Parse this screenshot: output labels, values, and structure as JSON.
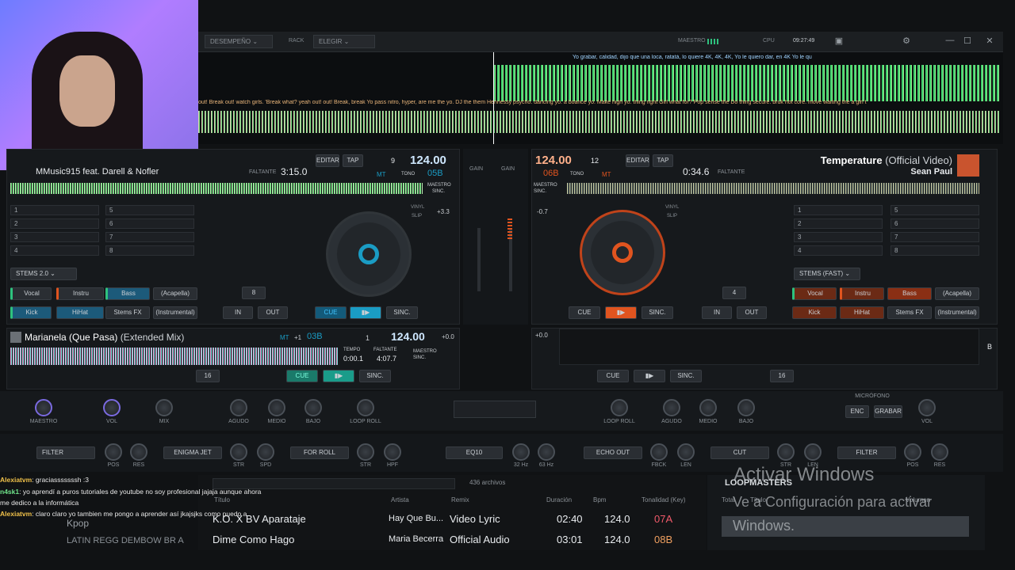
{
  "topbar": {
    "performance": "DESEMPEÑO",
    "rack_label": "RACK",
    "rack_value": "ELEGIR",
    "master_label": "MAESTRO",
    "cpu_label": "CPU",
    "clock": "09:27:49"
  },
  "wave_top": {
    "lyrics_top": "Yo grabar, calidad, dijo que una loca, ratatá, lo quiere 4K, 4K, 4K, Yo  le quiero dar, en 4K  Yo le qu",
    "lyrics_bottom": "out! Break out! watch girls.   'Break what? yeah out! out! Break,  break Yo pass nitro, hyper, are me the yo. DJ the them Hennessy psycho. dancing yo. a boance yo. Make high yo. thing right Girl what for? Pop sense the Do thing secure. bruk hot core. move waiting the a girl t"
  },
  "deck1": {
    "title": "MMusic915 feat. Darell & Nofler",
    "remaining_label": "FALTANTE",
    "time": "3:15.0",
    "edit": "EDITAR",
    "tap": "TAP",
    "bpm": "124.00",
    "beat": "9",
    "key": "05B",
    "mt": "MT",
    "tono": "TONO",
    "master": "MAESTRO",
    "sync": "SINC.",
    "pitch": "+3.3",
    "vinyl": "VINYL",
    "slip": "SLIP",
    "stems": "STEMS 2.0",
    "vocal": "Vocal",
    "instru": "Instru",
    "bass": "Bass",
    "acapella": "(Acapella)",
    "kick": "Kick",
    "hihat": "HiHat",
    "stemsfx": "Stems FX",
    "instrumental": "(Instrumental)",
    "loop": "8",
    "in": "IN",
    "out": "OUT",
    "cue": "CUE",
    "play": "▶ॱ",
    "sinc": "SINC.",
    "pads": [
      "1",
      "2",
      "3",
      "4",
      "5",
      "6",
      "7",
      "8"
    ]
  },
  "deck2": {
    "title": "Temperature",
    "title_suffix": "(Official Video)",
    "artist": "Sean Paul",
    "bpm": "124.00",
    "beat": "12",
    "key": "06B",
    "mt": "MT",
    "tono": "TONO",
    "edit": "EDITAR",
    "tap": "TAP",
    "time": "0:34.6",
    "remaining_label": "FALTANTE",
    "master": "MAESTRO",
    "sync": "SINC.",
    "pitch": "-0.7",
    "vinyl": "VINYL",
    "slip": "SLIP",
    "stems": "STEMS (FAST)",
    "vocal": "Vocal",
    "instru": "Instru",
    "bass": "Bass",
    "acapella": "(Acapella)",
    "kick": "Kick",
    "hihat": "HiHat",
    "stemsfx": "Stems FX",
    "instrumental": "(Instrumental)",
    "loop": "4",
    "in": "IN",
    "out": "OUT",
    "cue": "CUE",
    "sinc": "SINC.",
    "pads": [
      "1",
      "2",
      "3",
      "4",
      "5",
      "6",
      "7",
      "8"
    ]
  },
  "deck3": {
    "title": "Marianela (Que Pasa)",
    "title_suffix": "(Extended Mix)",
    "mt": "MT",
    "pitch_shift": "+1",
    "key": "03B",
    "beat": "1",
    "bpm": "124.00",
    "tempo_label": "TEMPO",
    "tempo": "0:00.1",
    "remaining_label": "FALTANTE",
    "time": "4:07.7",
    "master": "MAESTRO",
    "sync": "SINC.",
    "pitch": "+0.0",
    "loop": "16",
    "cue": "CUE",
    "sinc": "SINC."
  },
  "deck4": {
    "pitch": "+0.0",
    "loop": "16",
    "cue": "CUE",
    "sinc": "SINC.",
    "side": "B"
  },
  "mixer": {
    "gain": "GAIN",
    "master": "MAESTRO",
    "vol": "VOL",
    "mix": "MIX",
    "agudo": "AGUDO",
    "medio": "MEDIO",
    "bajo": "BAJO",
    "loop_roll": "LOOP ROLL",
    "microfono": "MICRÓFONO",
    "enc": "ENC",
    "grabar": "GRABAR",
    "vol2": "VOL"
  },
  "fx": {
    "filter": "FILTER",
    "pos": "POS",
    "res": "RES",
    "enigma": "ENIGMA JET",
    "str": "STR",
    "spd": "SPD",
    "for_roll": "FOR ROLL",
    "hpf": "HPF",
    "eq10": "EQ10",
    "hz32": "32 Hz",
    "hz63": "63 Hz",
    "echo_out": "ECHO OUT",
    "fbck": "FBCK",
    "len": "LEN",
    "cut": "CUT",
    "filter2": "FILTER",
    "pos2": "POS",
    "res2": "RES",
    "str2": "STR",
    "len2": "LEN"
  },
  "browser": {
    "count": "436 archivos",
    "headers": [
      "Título",
      "Artista",
      "Remix",
      "Duración",
      "Bpm",
      "Tonalidad (Key)"
    ],
    "rows": [
      {
        "title": "K.O. X BV Aparataje",
        "artist": "Hay Que Bu...",
        "remix": "Video Lyric",
        "duration": "02:40",
        "bpm": "124.0",
        "key": "07A"
      },
      {
        "title": "Dime Como Hago",
        "artist": "Maria Becerra",
        "remix": "Official Audio",
        "duration": "03:01",
        "bpm": "124.0",
        "key": "08B"
      }
    ],
    "folders": [
      "Kpop",
      "LATIN REGG DEMBOW BR A"
    ],
    "side_title": "LOOPMASTERS",
    "side_headers": [
      "Total",
      "Título",
      "Volumen"
    ]
  },
  "chat": [
    {
      "user": "Alexiatvm",
      "msg": ": graciasssssssh :3"
    },
    {
      "user": "n4sk1",
      "msg": ": yo aprendí a puros tutoriales de youtube no soy profesional jajaja aunque ahora me dedico a la informática"
    },
    {
      "user": "Alexiatvm",
      "msg": ": claro claro yo tambien me pongo a aprender así jkajsjks como puedo a"
    }
  ],
  "watermark": {
    "line1": "Activar Windows",
    "line2": "Ve a Configuración para activar",
    "line3": "Windows."
  },
  "colors": {
    "accent_blue": "#1a9cc4",
    "accent_orange": "#e0541f",
    "green": "#2ec27e"
  }
}
